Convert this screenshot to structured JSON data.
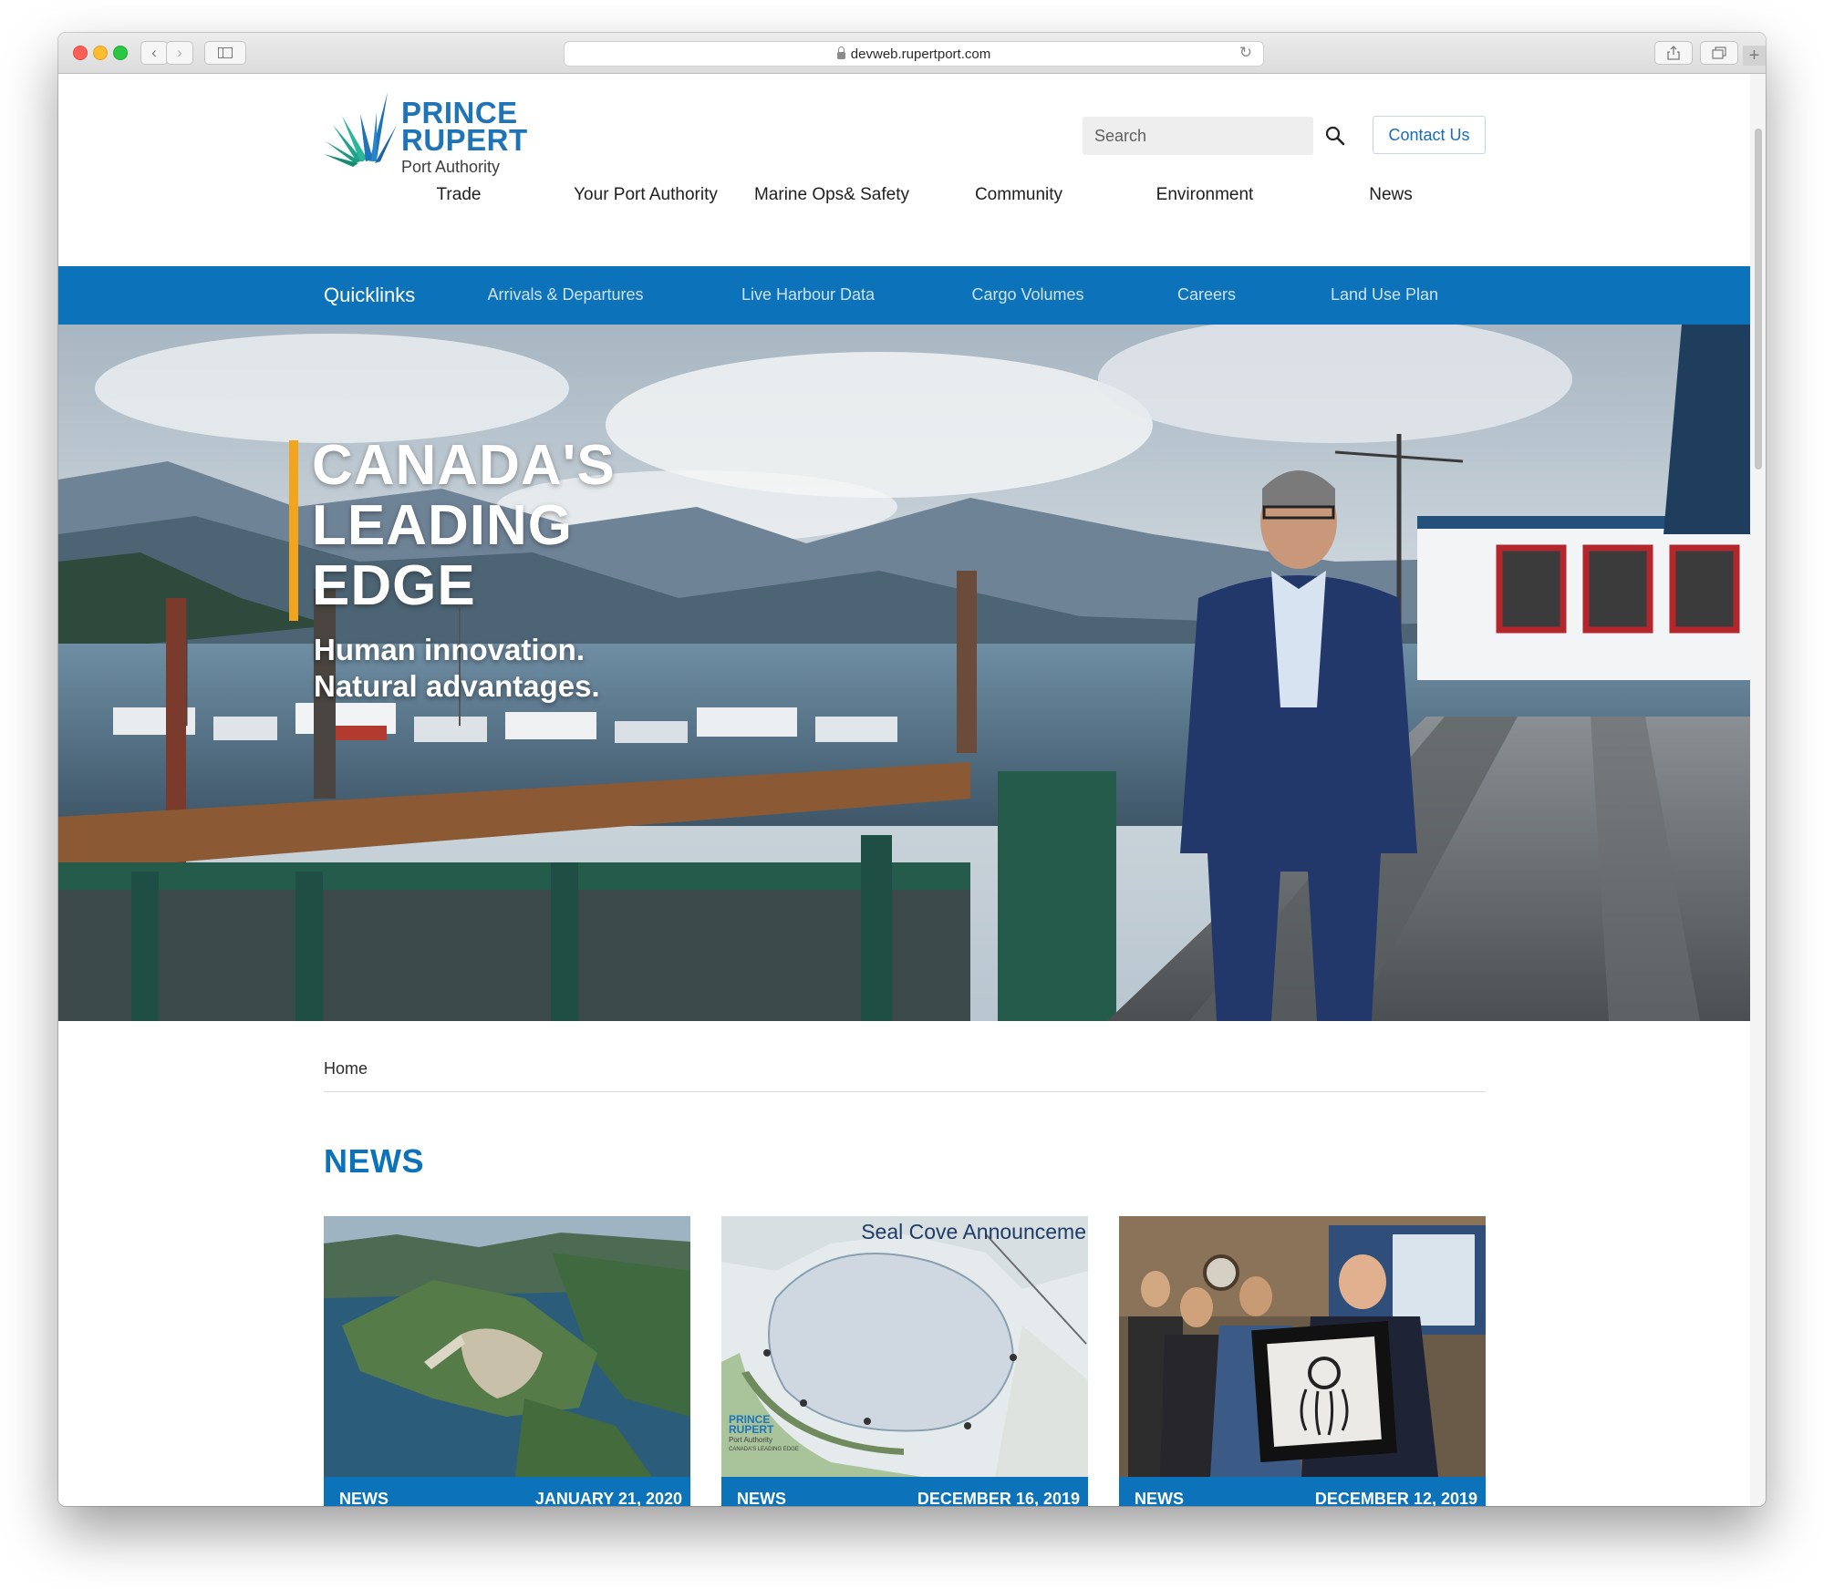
{
  "browser": {
    "url": "devweb.rupertport.com"
  },
  "site": {
    "logo": {
      "line1": "PRINCE",
      "line2": "RUPERT",
      "line3": "Port Authority"
    },
    "search": {
      "placeholder": "Search"
    },
    "contact_label": "Contact Us",
    "nav": [
      "Trade",
      "Your Port Authority",
      "Marine Ops& Safety",
      "Community",
      "Environment",
      "News"
    ],
    "quicklinks": {
      "title": "Quicklinks",
      "items": [
        "Arrivals & Departures",
        "Live Harbour Data",
        "Cargo Volumes",
        "Careers",
        "Land Use Plan"
      ]
    }
  },
  "hero": {
    "title_lines": [
      "CANADA'S",
      "LEADING",
      "EDGE"
    ],
    "subtitle_lines": [
      "Human innovation.",
      "Natural advantages."
    ]
  },
  "breadcrumb": "Home",
  "news": {
    "heading": "NEWS",
    "cards": [
      {
        "category": "NEWS",
        "date": "JANUARY 21, 2020"
      },
      {
        "category": "NEWS",
        "date": "DECEMBER 16, 2019",
        "image_caption": "Seal Cove Announceme",
        "image_logo_line1": "PRINCE",
        "image_logo_line2": "RUPERT",
        "image_logo_line3": "Port Authority",
        "image_logo_line4": "CANADA'S LEADING EDGE"
      },
      {
        "category": "NEWS",
        "date": "DECEMBER 12, 2019"
      }
    ]
  },
  "colors": {
    "brand_blue": "#0c72b9",
    "logo_teal": "#1fa38a",
    "hero_accent": "#f2a51c"
  }
}
